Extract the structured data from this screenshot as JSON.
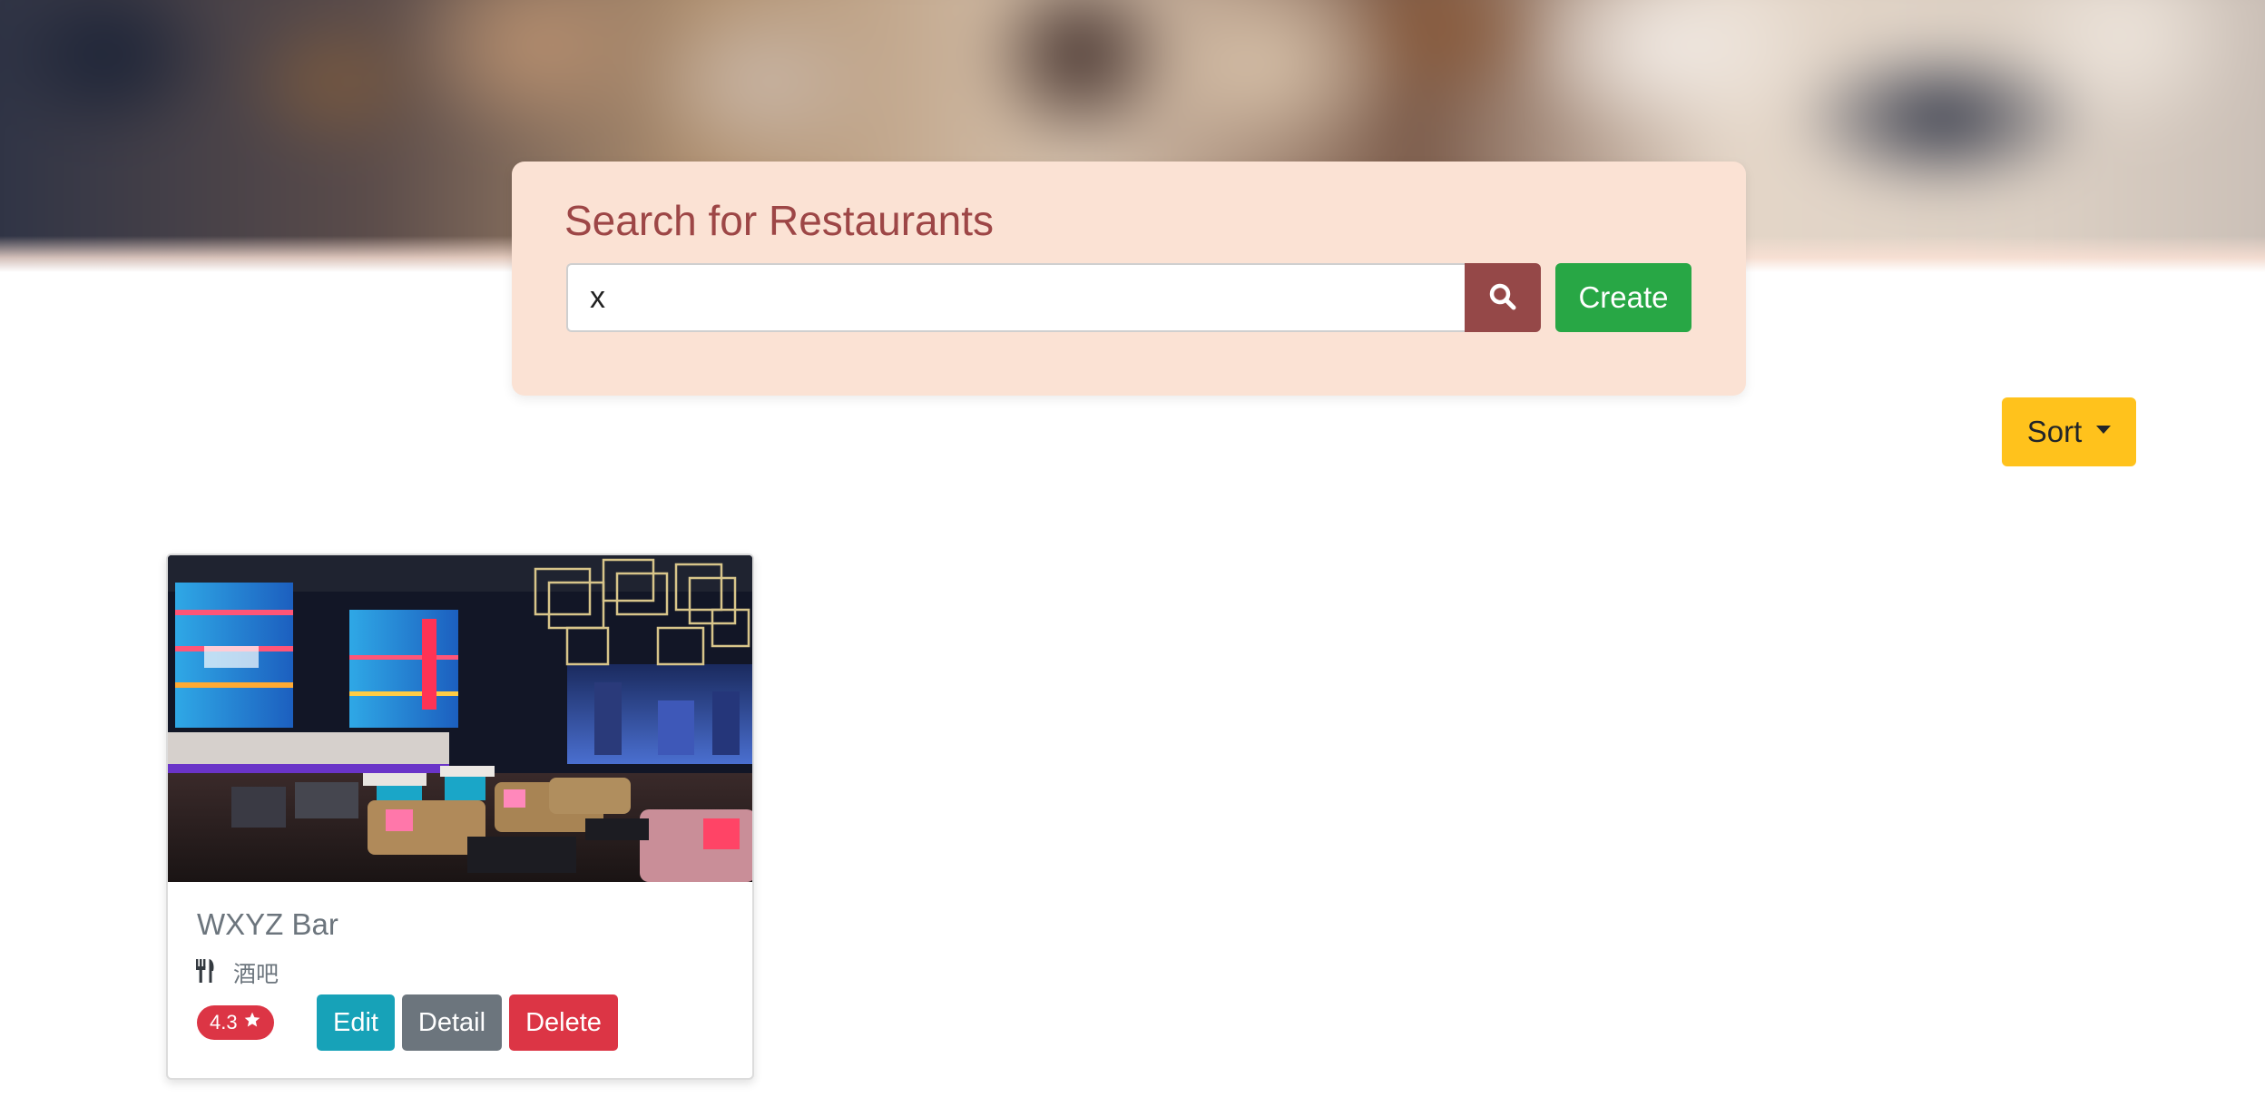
{
  "search": {
    "title": "Search for Restaurants",
    "query_value": "x",
    "search_button_icon": "search-icon",
    "create_label": "Create"
  },
  "sort": {
    "label": "Sort"
  },
  "restaurants": [
    {
      "name": "WXYZ Bar",
      "category_icon": "utensils-icon",
      "category": "酒吧",
      "rating": "4.3",
      "rating_icon": "star-icon",
      "actions": {
        "edit_label": "Edit",
        "detail_label": "Detail",
        "delete_label": "Delete"
      }
    }
  ],
  "colors": {
    "panel_bg": "#fbe2d4",
    "title_color": "#9d4646",
    "search_button": "#954848",
    "create_button": "#28a745",
    "sort_button": "#ffc21c",
    "edit_button": "#17a2b8",
    "detail_button": "#6c757d",
    "delete_button": "#dc3545"
  }
}
